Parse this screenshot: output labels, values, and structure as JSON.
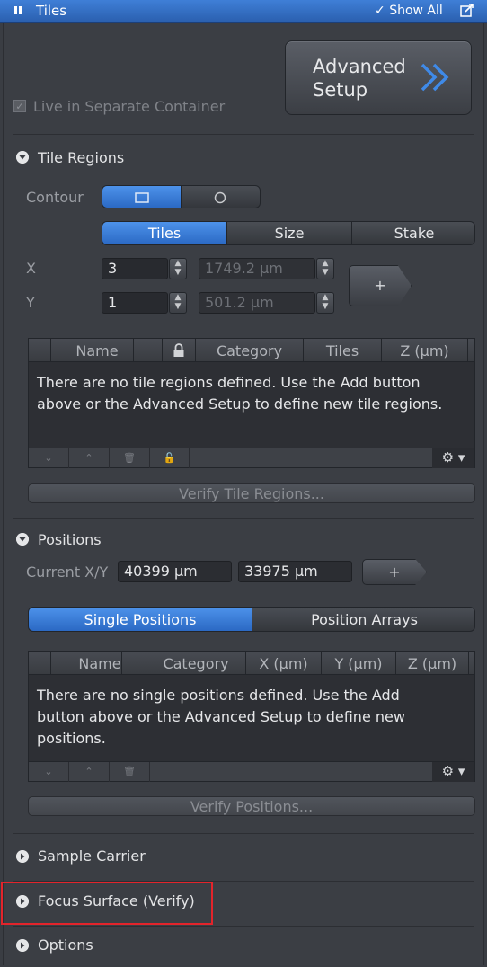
{
  "window": {
    "title": "Tiles",
    "show_all": "Show All"
  },
  "advanced_setup": {
    "line1": "Advanced",
    "line2": "Setup",
    "arrow": "»"
  },
  "live_container": {
    "label": "Live in Separate Container",
    "checked": true
  },
  "tile_regions": {
    "header": "Tile Regions",
    "contour_label": "Contour",
    "contour_options": [
      "rectangle-icon",
      "circle-icon"
    ],
    "tabs": [
      "Tiles",
      "Size",
      "Stake"
    ],
    "x_label": "X",
    "y_label": "Y",
    "x_value": "3",
    "y_value": "1",
    "x_size": "1749.2 µm",
    "y_size": "501.2 µm",
    "add_label": "+",
    "columns": [
      "Name",
      "",
      "Category",
      "Tiles",
      "Z (µm)"
    ],
    "empty_msg_line1": "There are no tile regions defined. Use the Add button",
    "empty_msg_line2": "above or the Advanced Setup to define new tile regions.",
    "verify_label": "Verify Tile Regions..."
  },
  "positions": {
    "header": "Positions",
    "current_label": "Current X/Y",
    "current_x": "40399 µm",
    "current_y": "33975 µm",
    "add_label": "+",
    "tabs": [
      "Single Positions",
      "Position Arrays"
    ],
    "columns": [
      "Name",
      "",
      "Category",
      "X (µm)",
      "Y (µm)",
      "Z (µm)"
    ],
    "empty_msg_line1": "There are no single positions defined. Use the Add",
    "empty_msg_line2": "button above or the Advanced Setup to define new",
    "empty_msg_line3": "positions.",
    "verify_label": "Verify Positions..."
  },
  "collapsed_sections": [
    {
      "label": "Sample Carrier"
    },
    {
      "label": "Focus Surface (Verify)"
    },
    {
      "label": "Options"
    }
  ],
  "colors": {
    "accent": "#3f7fd7",
    "highlight_box": "#e3242b"
  }
}
